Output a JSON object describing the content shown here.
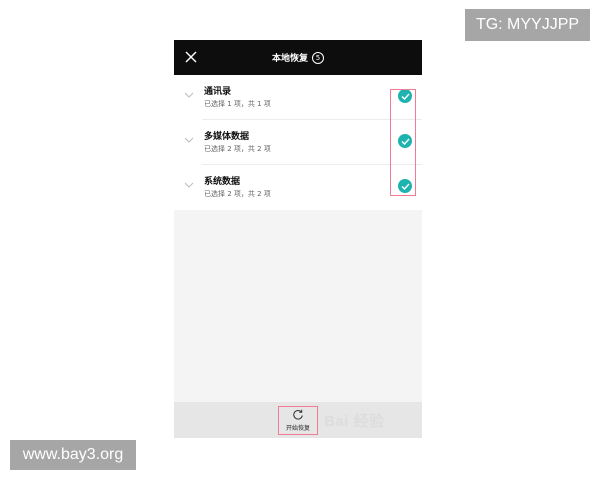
{
  "overlays": {
    "top_right_badge": "TG: MYYJJPP",
    "bottom_left_badge": "www.bay3.org"
  },
  "header": {
    "title": "本地恢复",
    "count": "5",
    "close_icon": "close-icon"
  },
  "items": [
    {
      "name": "通讯录",
      "subtitle": "已选择 1 项，共 1 项",
      "checked": true
    },
    {
      "name": "多媒体数据",
      "subtitle": "已选择 2 项，共 2 项",
      "checked": true
    },
    {
      "name": "系统数据",
      "subtitle": "已选择 2 项，共 2 项",
      "checked": true
    }
  ],
  "bottom": {
    "restore_label": "开始恢复",
    "restore_icon": "refresh-icon",
    "watermark": "Bai 经验"
  },
  "colors": {
    "header_bg": "#0d0d0d",
    "check_accent": "#1fb3b0",
    "highlight_border": "#f07b95"
  }
}
